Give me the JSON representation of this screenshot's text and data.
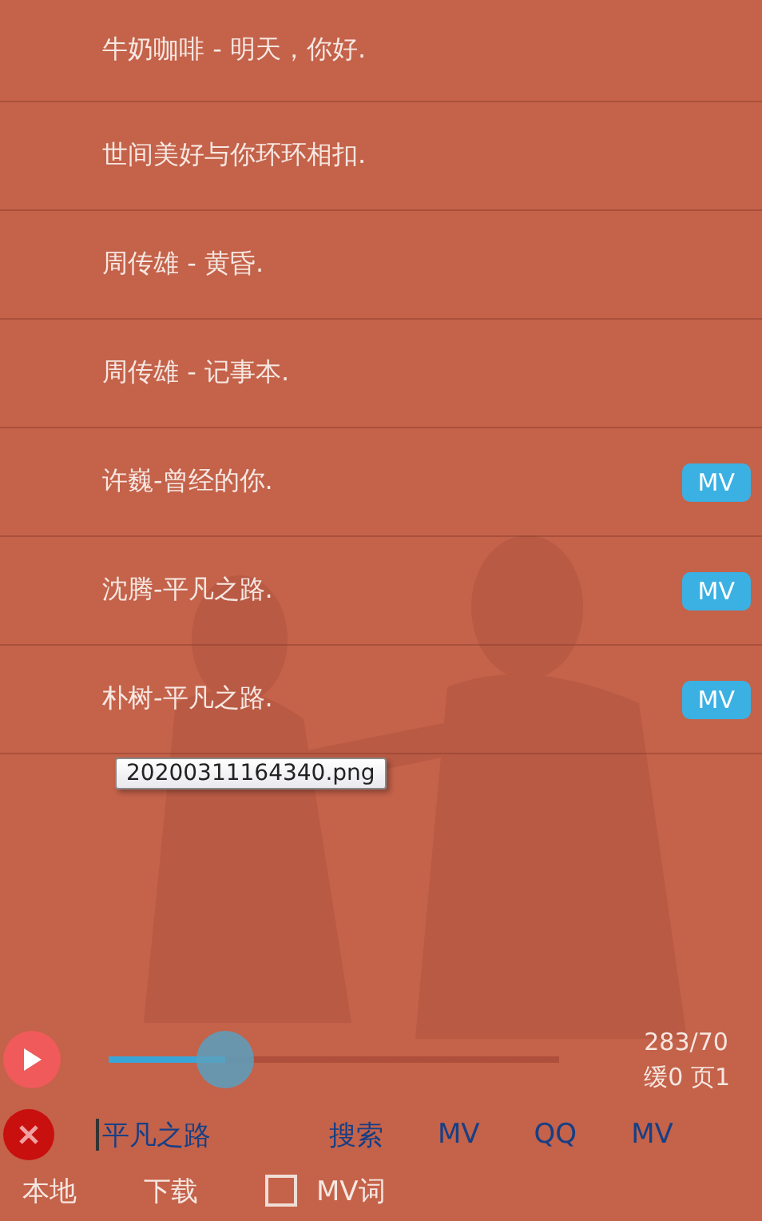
{
  "songs": [
    {
      "title": "牛奶咖啡 - 明天，你好."
    },
    {
      "title": "世间美好与你环环相扣."
    },
    {
      "title": "周传雄 - 黄昏."
    },
    {
      "title": "周传雄 - 记事本."
    },
    {
      "title": "许巍-曾经的你.",
      "badge": "MV"
    },
    {
      "title": "沈腾-平凡之路.",
      "badge": "MV"
    },
    {
      "title": "朴树-平凡之路.",
      "badge": "MV"
    }
  ],
  "tooltip": "20200311164340.png",
  "player": {
    "playing": false,
    "level": 0.26,
    "counts": "283/70",
    "status": "缓0 页1"
  },
  "search": {
    "value": "平凡之路",
    "buttons": [
      "搜索",
      "MV",
      "QQ",
      "MV"
    ]
  },
  "bottom": {
    "tabs": [
      "本地",
      "下载"
    ],
    "checkbox": {
      "label": "MV词",
      "checked": false
    }
  }
}
